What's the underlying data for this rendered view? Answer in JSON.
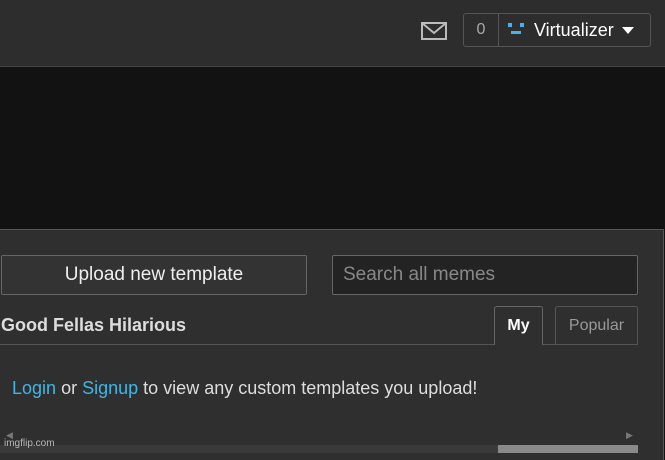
{
  "header": {
    "notification_count": "0",
    "username": "Virtualizer",
    "icons": {
      "mail": "mail-icon",
      "avatar": "avatar-icon",
      "caret": "chevron-down-icon"
    },
    "accent_color": "#3fb6e7"
  },
  "panel": {
    "upload_label": "Upload new template",
    "search_placeholder": "Search all memes",
    "title": "Good Fellas Hilarious",
    "tabs": [
      {
        "label": "My",
        "active": true
      },
      {
        "label": "Popular",
        "active": false
      }
    ],
    "message": {
      "login": "Login",
      "or": "or",
      "signup": "Signup",
      "rest": "to view any custom templates you upload!"
    }
  },
  "watermark": "imgflip.com"
}
